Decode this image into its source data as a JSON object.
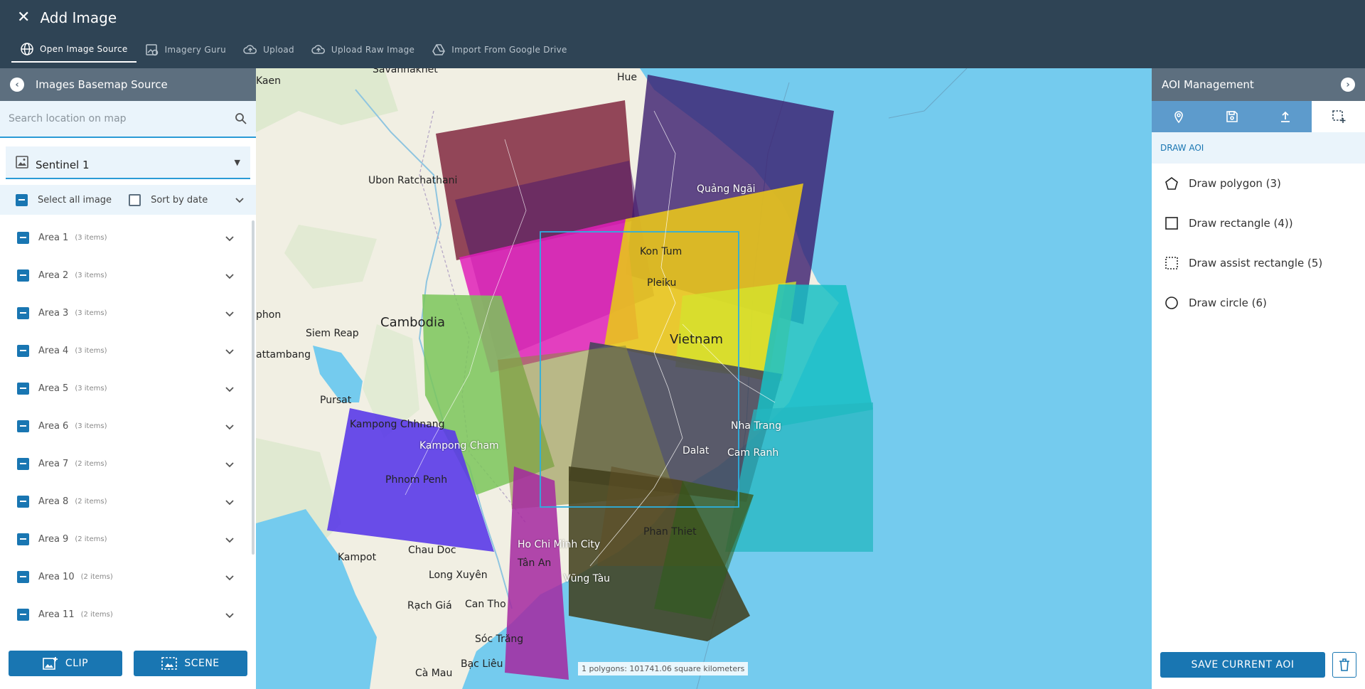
{
  "header": {
    "title": "Add Image",
    "tabs": [
      {
        "label": "Open Image Source",
        "icon": "globe-icon",
        "active": true
      },
      {
        "label": "Imagery Guru",
        "icon": "imagery-guru-icon",
        "active": false
      },
      {
        "label": "Upload",
        "icon": "cloud-upload-icon",
        "active": false
      },
      {
        "label": "Upload Raw Image",
        "icon": "cloud-upload-icon",
        "active": false
      },
      {
        "label": "Import From Google Drive",
        "icon": "google-drive-icon",
        "active": false
      }
    ]
  },
  "left_panel": {
    "title": "Images Basemap Source",
    "search_placeholder": "Search location on map",
    "source": "Sentinel 1",
    "select_all_label": "Select all image",
    "sort_label": "Sort by date",
    "areas": [
      {
        "name": "Area 1",
        "count": "(3 items)"
      },
      {
        "name": "Area 2",
        "count": "(3 items)"
      },
      {
        "name": "Area 3",
        "count": "(3 items)"
      },
      {
        "name": "Area 4",
        "count": "(3 items)"
      },
      {
        "name": "Area 5",
        "count": "(3 items)"
      },
      {
        "name": "Area 6",
        "count": "(3 items)"
      },
      {
        "name": "Area 7",
        "count": "(2 items)"
      },
      {
        "name": "Area 8",
        "count": "(2 items)"
      },
      {
        "name": "Area 9",
        "count": "(2 items)"
      },
      {
        "name": "Area 10",
        "count": "(2 items)"
      },
      {
        "name": "Area 11",
        "count": "(2 items)"
      }
    ],
    "clip_label": "CLIP",
    "scene_label": "SCENE"
  },
  "map": {
    "labels": {
      "savannakhet": "Savannakhet",
      "hue": "Hue",
      "kaen": "Kaen",
      "ubon": "Ubon Ratchathani",
      "quang_ngai": "Quảng Ngãi",
      "kon_tum": "Kon Tum",
      "pleiku": "Pleiku",
      "cambodia": "Cambodia",
      "vietnam": "Vietnam",
      "phon": "phon",
      "siem_reap": "Siem Reap",
      "battambang": "attambang",
      "pursat": "Pursat",
      "kampong_chhnang": "Kampong Chhnang",
      "kampong_cham": "Kampong Cham",
      "nha_trang": "Nha Trang",
      "dalat": "Dalat",
      "cam_ranh": "Cam Ranh",
      "phnom_penh": "Phnom Penh",
      "phan_thiet": "Phan Thiet",
      "kampot": "Kampot",
      "chau_doc": "Chau Doc",
      "hcmc": "Ho Chi Minh City",
      "tan_an": "Tân An",
      "long_xuyen": "Long Xuyên",
      "vung_tau": "Vũng Tàu",
      "rach_gia": "Rạch Giá",
      "can_tho": "Can Tho",
      "soc_trang": "Sóc Trăng",
      "ca_mau": "Cà Mau",
      "bac_lieu": "Bạc Liêu"
    },
    "scale_text": "1 polygons: 101741.06 square kilometers"
  },
  "right_panel": {
    "title": "AOI Management",
    "tabs": [
      "map-pin-icon",
      "save-icon",
      "upload-icon",
      "draw-aoi-icon"
    ],
    "subtitle": "DRAW AOI",
    "tools": [
      {
        "label": "Draw polygon (3)",
        "icon": "polygon-icon"
      },
      {
        "label": "Draw rectangle (4))",
        "icon": "rectangle-icon"
      },
      {
        "label": "Draw assist rectangle (5)",
        "icon": "dashed-rectangle-icon"
      },
      {
        "label": "Draw circle (6)",
        "icon": "circle-icon"
      }
    ],
    "save_label": "SAVE CURRENT AOI"
  }
}
